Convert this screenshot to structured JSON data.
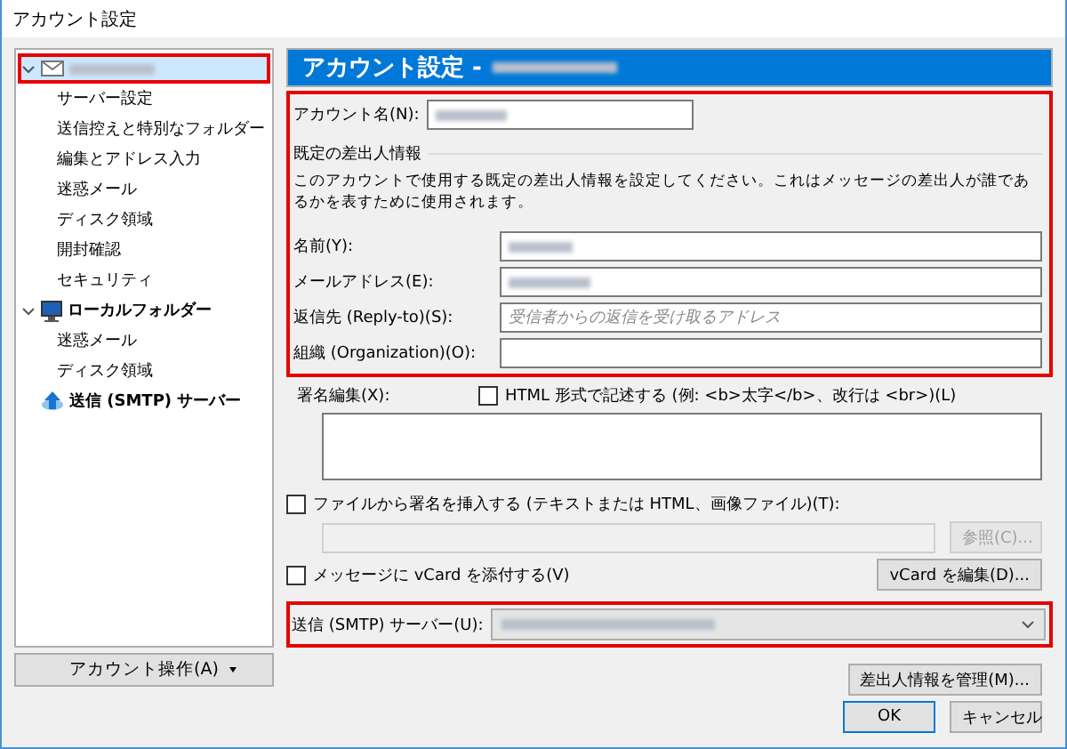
{
  "window": {
    "title": "アカウント設定"
  },
  "tree": [
    {
      "kind": "account",
      "selected": true,
      "highlighted": true,
      "expanded": true,
      "children": [
        {
          "label": "サーバー設定"
        },
        {
          "label": "送信控えと特別なフォルダー"
        },
        {
          "label": "編集とアドレス入力"
        },
        {
          "label": "迷惑メール"
        },
        {
          "label": "ディスク領域"
        },
        {
          "label": "開封確認"
        },
        {
          "label": "セキュリティ"
        }
      ]
    },
    {
      "kind": "local",
      "label": "ローカルフォルダー",
      "selected": false,
      "highlighted": false,
      "expanded": true,
      "children": [
        {
          "label": "迷惑メール"
        },
        {
          "label": "ディスク領域"
        }
      ]
    },
    {
      "kind": "smtp",
      "label": "送信 (SMTP) サーバー",
      "selected": false,
      "highlighted": false
    }
  ],
  "account_actions": "アカウント操作(A)",
  "panel": {
    "header": "アカウント設定 -",
    "account_name_label": "アカウント名(N):",
    "identity": {
      "highlighted": true,
      "legend": "既定の差出人情報",
      "description": "このアカウントで使用する既定の差出人情報を設定してください。これはメッセージの差出人が誰であるかを表すために使用されます。",
      "fields": [
        {
          "label": "名前(Y):",
          "kind": "blurred"
        },
        {
          "label": "メールアドレス(E):",
          "kind": "blurred"
        },
        {
          "label": "返信先 (Reply-to)(S):",
          "kind": "empty",
          "placeholder": "受信者からの返信を受け取るアドレス"
        },
        {
          "label": "組織 (Organization)(O):",
          "kind": "empty"
        }
      ]
    },
    "signature_label": "署名編集(X):",
    "html_checkbox": {
      "label": "HTML 形式で記述する (例: <b>太字</b>、改行は <br>)(L)",
      "checked": false
    },
    "file_checkbox": {
      "label": "ファイルから署名を挿入する (テキストまたは HTML、画像ファイル)(T):",
      "checked": false
    },
    "browse_button": {
      "label": "参照(C)...",
      "disabled": true
    },
    "vcard_checkbox": {
      "label": "メッセージに vCard を添付する(V)",
      "checked": false
    },
    "vcard_button": "vCard を編集(D)...",
    "smtp": {
      "label": "送信 (SMTP) サーバー(U):",
      "highlighted": true
    },
    "manage_button": "差出人情報を管理(M)..."
  },
  "buttons": {
    "ok": "OK",
    "cancel": "キャンセル"
  }
}
